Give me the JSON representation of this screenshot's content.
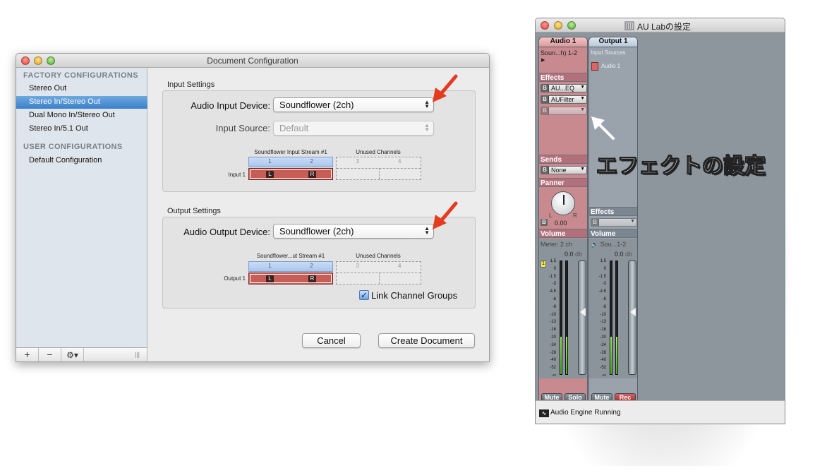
{
  "doc_window": {
    "title": "Document Configuration",
    "sidebar": {
      "factory_heading": "FACTORY CONFIGURATIONS",
      "factory_items": [
        "Stereo Out",
        "Stereo In/Stereo Out",
        "Dual Mono In/Stereo Out",
        "Stereo In/5.1 Out"
      ],
      "selected_item": "Stereo In/Stereo Out",
      "user_heading": "USER CONFIGURATIONS",
      "user_items": [
        "Default Configuration"
      ],
      "footer": {
        "add": "+",
        "remove": "−",
        "gear": "⚙▾",
        "resize": "|||"
      }
    },
    "input": {
      "group_label": "Input Settings",
      "device_label": "Audio Input Device:",
      "device_value": "Soundflower (2ch)",
      "source_label": "Input Source:",
      "source_value": "Default",
      "stream_title": "Soundflower Input Stream #1",
      "unused_title": "Unused Channels",
      "channels": [
        "1",
        "2"
      ],
      "unused_channels": [
        "3",
        "4"
      ],
      "row_label": "Input 1",
      "left": "L",
      "right": "R"
    },
    "output": {
      "group_label": "Output Settings",
      "device_label": "Audio Output Device:",
      "device_value": "Soundflower (2ch)",
      "stream_title": "Soundflower...ut Stream #1",
      "unused_title": "Unused Channels",
      "channels": [
        "1",
        "2"
      ],
      "unused_channels": [
        "3",
        "4"
      ],
      "row_label": "Output 1",
      "left": "L",
      "right": "R",
      "link_label": "Link Channel Groups",
      "link_checked": true
    },
    "buttons": {
      "cancel": "Cancel",
      "create": "Create Document"
    }
  },
  "au_window": {
    "title": "AU Labの設定",
    "strip1": {
      "name": "Audio 1",
      "source": "Soun...h) 1-2",
      "effects_label": "Effects",
      "effects": [
        "AU...EQ",
        "AUFilter",
        ""
      ],
      "sends_label": "Sends",
      "send_value": "None",
      "panner_label": "Panner",
      "pan_value": "0.00",
      "pan_l": "L",
      "pan_r": "R",
      "volume_label": "Volume",
      "meter_label": "Meter: 2 ch",
      "level": "0.0",
      "level_unit": "db",
      "channel_badge": "1",
      "mute": "Mute",
      "solo": "Solo",
      "meter_fill_fraction": 0.33
    },
    "strip2": {
      "name": "Output 1",
      "sources_label": "Input Sources",
      "source_item": "Audio 1",
      "effects_label": "Effects",
      "volume_label": "Volume",
      "device": "Sou...1-2",
      "level": "0.0",
      "level_unit": "db",
      "mute": "Mute",
      "rec": "Rec",
      "meter_fill_fraction": 0.33
    },
    "scale": [
      "1.5",
      "0",
      "-1.5",
      "-3",
      "-4.5",
      "-6",
      "-8",
      "-10",
      "-13",
      "-16",
      "-20",
      "-24",
      "-28",
      "-40",
      "-52",
      "-∞"
    ],
    "callout": "エフェクトの設定",
    "status": "Audio Engine Running",
    "bypass": "B"
  }
}
